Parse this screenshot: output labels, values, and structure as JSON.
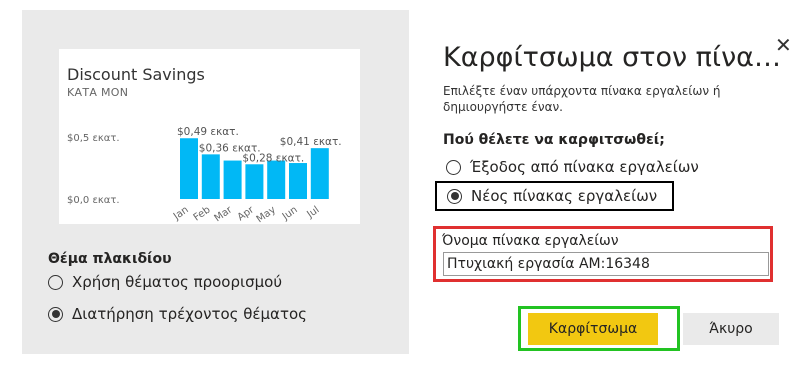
{
  "tile": {
    "title": "Discount Savings",
    "subtitle": "ΚΑΤΑ MON"
  },
  "chart_data": {
    "type": "bar",
    "categories": [
      "Jan",
      "Feb",
      "Mar",
      "Apr",
      "May",
      "Jun",
      "Jul"
    ],
    "values": [
      0.49,
      0.36,
      0.31,
      0.28,
      0.31,
      0.29,
      0.41
    ],
    "ytick_labels": [
      "$0,5 εκατ.",
      "$0,0 εκατ."
    ],
    "yticks": [
      0.5,
      0.0
    ],
    "ylim": [
      0,
      0.5
    ],
    "data_labels": [
      {
        "index": 0,
        "text": "$0,49 εκατ."
      },
      {
        "index": 1,
        "text": "$0,36 εκατ."
      },
      {
        "index": 3,
        "text": "$0,28 εκατ."
      },
      {
        "index": 6,
        "text": "$0,41 εκατ."
      }
    ],
    "bar_color": "#01b8f5"
  },
  "theme": {
    "heading": "Θέμα πλακιδίου",
    "options": [
      {
        "label": "Χρήση θέματος προορισμού",
        "selected": false
      },
      {
        "label": "Διατήρηση τρέχοντος θέματος",
        "selected": true
      }
    ]
  },
  "dialog": {
    "title": "Καρφίτσωμα στον πίνα…",
    "description": "Επιλέξτε έναν υπάρχοντα πίνακα εργαλείων ή δημιουργήστε έναν.",
    "where_heading": "Πού θέλετε να καρφιτσωθεί;",
    "options": [
      {
        "label": "Έξοδος από πίνακα εργαλείων",
        "selected": false
      },
      {
        "label": "Νέος πίνακας εργαλείων",
        "selected": true
      }
    ],
    "name_label": "Όνομα πίνακα εργαλείων",
    "name_value": "Πτυχιακή εργασία ΑΜ:16348",
    "pin_label": "Καρφίτσωμα",
    "cancel_label": "Άκυρο",
    "close_symbol": "✕"
  },
  "colors": {
    "accent": "#f2c811",
    "highlight_black": "#000000",
    "highlight_red": "#e03030",
    "highlight_green": "#22c322"
  }
}
